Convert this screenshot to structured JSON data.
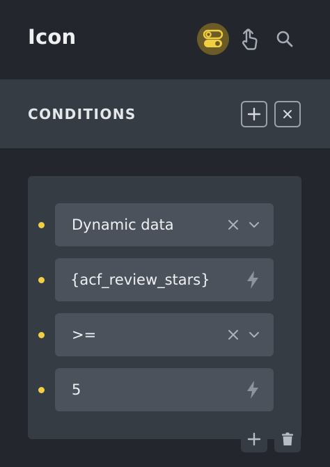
{
  "header": {
    "title": "Icon",
    "icons": [
      "toggle-icon",
      "hand-pointer-icon",
      "search-icon"
    ]
  },
  "conditions": {
    "title": "CONDITIONS",
    "icons": [
      "plus-icon",
      "close-icon"
    ]
  },
  "condition_group": {
    "rows": [
      {
        "value": "Dynamic data",
        "kind": "select"
      },
      {
        "value": "{acf_review_stars}",
        "kind": "dynamic"
      },
      {
        "value": ">=",
        "kind": "select"
      },
      {
        "value": "5",
        "kind": "dynamic"
      }
    ],
    "footer_icons": [
      "plus-icon",
      "trash-icon"
    ]
  },
  "colors": {
    "background": "#23272d",
    "bar": "#363c44",
    "field": "#4b525b",
    "accent": "#f1cf43",
    "active_toggle_bg": "#6b5b26"
  }
}
